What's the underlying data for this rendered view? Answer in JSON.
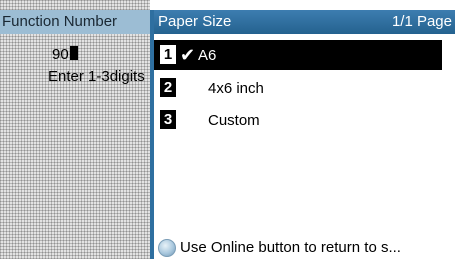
{
  "background": {
    "header": "Function Number",
    "input_value": "90",
    "hint": "Enter 1-3digits"
  },
  "dialog": {
    "title": "Paper Size",
    "page": "1/1 Page",
    "items": [
      {
        "number": "1",
        "label": "A6",
        "selected": true
      },
      {
        "number": "2",
        "label": "4x6 inch",
        "selected": false
      },
      {
        "number": "3",
        "label": "Custom",
        "selected": false
      }
    ],
    "check_glyph": "✔",
    "status_icon": "online-led-icon",
    "status_text": "Use Online button to return to s..."
  },
  "colors": {
    "header_blue": "#24628f",
    "bg_header": "#9cbdd4",
    "selected_bg": "#000000"
  }
}
